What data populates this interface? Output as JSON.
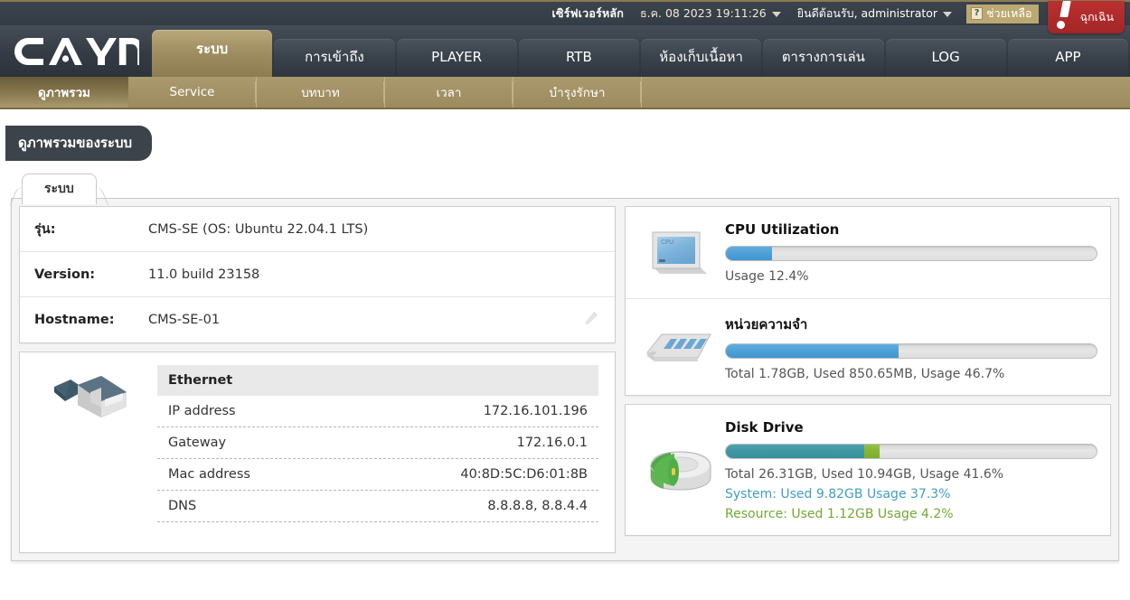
{
  "topbar": {
    "server": "เซิร์ฟเวอร์หลัก",
    "datetime": "ธ.ค. 08 2023 19:11:26",
    "welcome": "ยินดีต้อนรับ, administrator",
    "help_label": "ช่วยเหลือ",
    "help_mark": "?",
    "emergency_label": "ฉุกเฉิน"
  },
  "brand": {
    "logo_text": "CAYIN"
  },
  "nav": {
    "tabs": [
      {
        "label": "ระบบ",
        "active": true
      },
      {
        "label": "การเข้าถึง",
        "active": false
      },
      {
        "label": "PLAYER",
        "active": false
      },
      {
        "label": "RTB",
        "active": false
      },
      {
        "label": "ห้องเก็บเนื้อหา",
        "active": false
      },
      {
        "label": "ตารางการเล่น",
        "active": false
      },
      {
        "label": "LOG",
        "active": false
      },
      {
        "label": "APP",
        "active": false
      }
    ]
  },
  "subnav": {
    "items": [
      {
        "label": "ดูภาพรวม",
        "active": true
      },
      {
        "label": "Service",
        "active": false
      },
      {
        "label": "บทบาท",
        "active": false
      },
      {
        "label": "เวลา",
        "active": false
      },
      {
        "label": "บำรุงรักษา",
        "active": false
      }
    ]
  },
  "page": {
    "title": "ดูภาพรวมของระบบ",
    "content_tab": "ระบบ"
  },
  "system_info": {
    "rows": [
      {
        "label": "รุ่น:",
        "value": "CMS-SE (OS: Ubuntu 22.04.1 LTS)"
      },
      {
        "label": "Version:",
        "value": "11.0 build 23158"
      },
      {
        "label": "Hostname:",
        "value": "CMS-SE-01"
      }
    ]
  },
  "ethernet": {
    "title": "Ethernet",
    "rows": [
      {
        "label": "IP address",
        "value": "172.16.101.196"
      },
      {
        "label": "Gateway",
        "value": "172.16.0.1"
      },
      {
        "label": "Mac address",
        "value": "40:8D:5C:D6:01:8B"
      },
      {
        "label": "DNS",
        "value": "8.8.8.8, 8.8.4.4"
      }
    ]
  },
  "cpu": {
    "title": "CPU Utilization",
    "percent": 12.4,
    "detail": "Usage 12.4%",
    "color": "#4fa0d8"
  },
  "memory": {
    "title": "หน่วยความจำ",
    "percent": 46.7,
    "detail": "Total 1.78GB, Used 850.65MB, Usage 46.7%",
    "color": "#4fa0d8"
  },
  "disk": {
    "title": "Disk Drive",
    "system_percent": 37.3,
    "resource_percent": 4.2,
    "detail": "Total 26.31GB, Used 10.94GB, Usage 41.6%",
    "system_detail": "System: Used 9.82GB Usage 37.3%",
    "resource_detail": "Resource: Used 1.12GB Usage 4.2%",
    "system_color": "#3f96a3",
    "resource_color": "#84b534"
  },
  "icons": {
    "cpu": "cpu-chip-icon",
    "memory": "memory-module-icon",
    "disk": "hard-drive-icon",
    "ethernet": "rj45-cable-icon",
    "edit": "pencil-icon"
  }
}
